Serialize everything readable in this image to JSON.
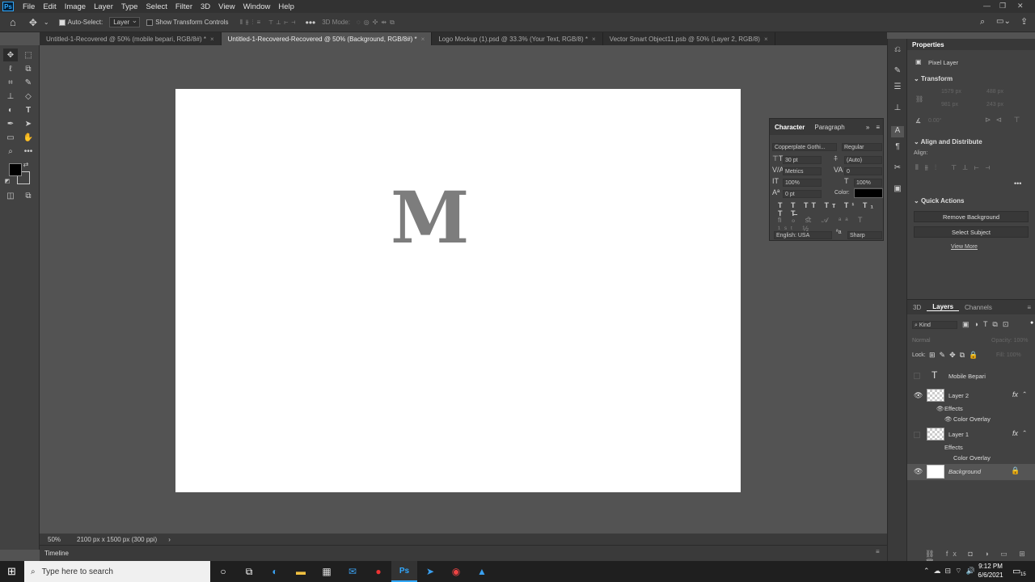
{
  "menu": [
    "File",
    "Edit",
    "Image",
    "Layer",
    "Type",
    "Select",
    "Filter",
    "3D",
    "View",
    "Window",
    "Help"
  ],
  "options": {
    "auto_select": "Auto-Select:",
    "layer_select": "Layer",
    "show_transform": "Show Transform Controls",
    "mode_3d": "3D Mode:"
  },
  "tabs": [
    {
      "label": "Untitled-1-Recovered @ 50% (mobile bepari, RGB/8#) *",
      "active": false
    },
    {
      "label": "Untitled-1-Recovered-Recovered @ 50% (Background, RGB/8#) *",
      "active": true
    },
    {
      "label": "Logo Mockup (1).psd @ 33.3% (Your Text, RGB/8) *",
      "active": false
    },
    {
      "label": "Vector Smart Object11.psb @ 50% (Layer 2, RGB/8)",
      "active": false
    }
  ],
  "tab_close": "×",
  "canvas": {
    "text": "M"
  },
  "status": {
    "zoom": "50%",
    "doc_info": "2100 px x 1500 px (300 ppi)"
  },
  "timeline": "Timeline",
  "character": {
    "tabs": [
      "Character",
      "Paragraph"
    ],
    "font": "Copperplate Gothi...",
    "style": "Regular",
    "size": "30 pt",
    "leading": "(Auto)",
    "kerning": "Metrics",
    "tracking": "0",
    "vscale": "100%",
    "hscale": "100%",
    "baseline": "0 pt",
    "color_label": "Color:",
    "language": "English: USA",
    "antialias": "Sharp"
  },
  "properties": {
    "title": "Properties",
    "pixel_layer": "Pixel Layer",
    "transform": "Transform",
    "w": "1579 px",
    "x": "488 px",
    "h": "981 px",
    "y": "243 px",
    "angle": "0.00°",
    "align": "Align and Distribute",
    "align_label": "Align:",
    "quick": "Quick Actions",
    "remove_bg": "Remove Background",
    "select_subject": "Select Subject",
    "view_more": "View More"
  },
  "layers_panel": {
    "tabs": [
      "3D",
      "Layers",
      "Channels"
    ],
    "kind": "Kind",
    "blend": "Normal",
    "opacity": "Opacity: 100%",
    "lock": "Lock:",
    "fill": "Fill: 100%",
    "layers": [
      {
        "name": "Mobile Bepari"
      },
      {
        "name": "Layer 2",
        "effects": "Effects",
        "effect": "Color Overlay"
      },
      {
        "name": "Layer 1",
        "effects": "Effects",
        "effect": "Color Overlay"
      },
      {
        "name": "Background"
      }
    ]
  },
  "taskbar": {
    "search": "Type here to search",
    "time": "9:12 PM",
    "date": "6/6/2021",
    "notif": "15"
  },
  "colors": {
    "fg": "#000000",
    "bg": "#ffffff",
    "accent": "#31a8ff"
  }
}
